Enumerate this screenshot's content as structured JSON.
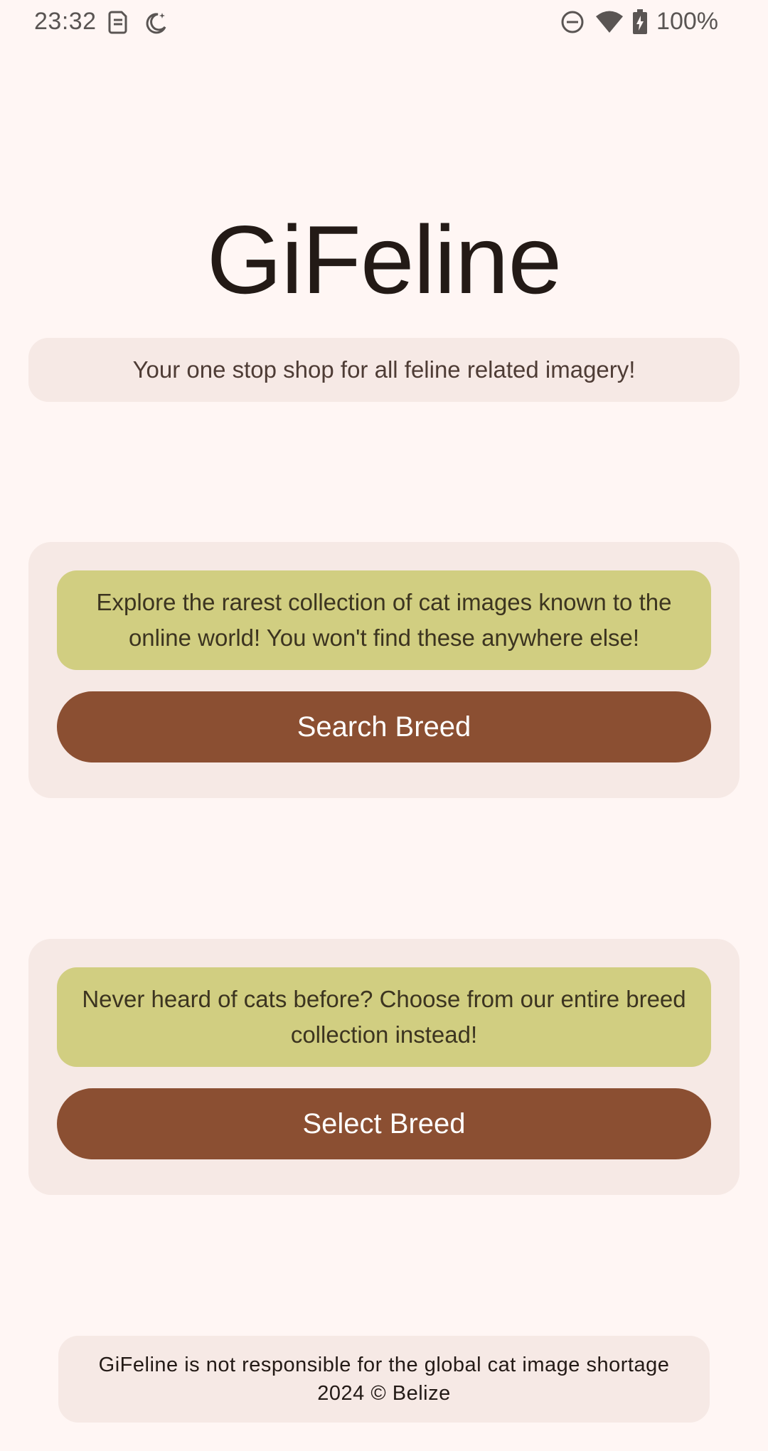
{
  "status_bar": {
    "time": "23:32",
    "left_icons": [
      "sim-card-icon",
      "moon-stars-icon"
    ],
    "right_icons": [
      "do-not-disturb-icon",
      "wifi-icon",
      "battery-charging-icon"
    ],
    "battery_percent": "100%"
  },
  "app": {
    "title": "GiFeline",
    "tagline": "Your one stop shop for all feline related imagery!"
  },
  "search_card": {
    "note": "Explore the rarest collection of cat images known to the online world! You won't find these anywhere else!",
    "button_label": "Search Breed"
  },
  "select_card": {
    "note": "Never heard of cats before? Choose from our entire breed collection instead!",
    "button_label": "Select Breed"
  },
  "footer": {
    "disclaimer": "GiFeline is not responsible for the global cat image shortage",
    "copyright": "2024 © Belize"
  },
  "colors": {
    "background": "#FFF6F4",
    "surface": "#F6E9E5",
    "note_bg": "#D1CE81",
    "button_bg": "#8B4F32",
    "button_text": "#FFFFFF",
    "title_text": "#231A16"
  }
}
